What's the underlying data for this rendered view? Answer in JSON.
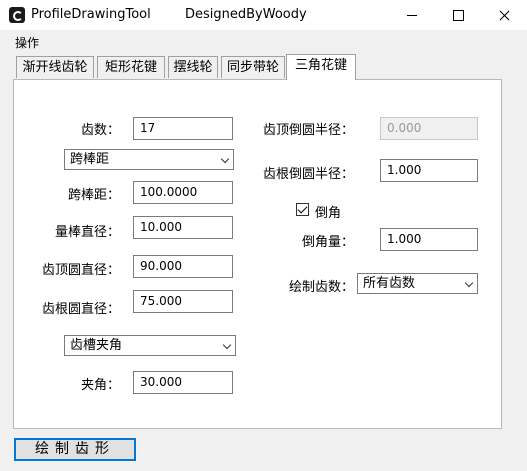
{
  "window": {
    "title": "ProfileDrawingTool",
    "subtitle": "DesignedByWoody"
  },
  "menu": {
    "items": [
      "操作"
    ]
  },
  "tabs": [
    {
      "label": "渐开线齿轮",
      "active": false
    },
    {
      "label": "矩形花键",
      "active": false
    },
    {
      "label": "摆线轮",
      "active": false
    },
    {
      "label": "同步带轮",
      "active": false
    },
    {
      "label": "三角花键",
      "active": true
    }
  ],
  "form": {
    "teeth_label": "齿数：",
    "teeth_value": "17",
    "measure_select": "跨棒距",
    "span_label": "跨棒距：",
    "span_value": "100.0000",
    "rod_dia_label": "量棒直径：",
    "rod_dia_value": "10.000",
    "tip_dia_label": "齿顶圆直径：",
    "tip_dia_value": "90.000",
    "root_dia_label": "齿根圆直径：",
    "root_dia_value": "75.000",
    "angle_select": "齿槽夹角",
    "angle_label": "夹角：",
    "angle_value": "30.000",
    "tip_fillet_label": "齿顶倒圆半径：",
    "tip_fillet_value": "0.000",
    "root_fillet_label": "齿根倒圆半径：",
    "root_fillet_value": "1.000",
    "chamfer_check_label": "倒角",
    "chamfer_checked": true,
    "chamfer_label": "倒角量：",
    "chamfer_value": "1.000",
    "draw_teeth_label": "绘制齿数：",
    "draw_teeth_select": "所有齿数"
  },
  "actions": {
    "draw_button": "绘制齿形"
  },
  "colors": {
    "focus_border": "#0078d7",
    "panel_bg": "#ffffff",
    "window_bg": "#f0f0f0"
  }
}
